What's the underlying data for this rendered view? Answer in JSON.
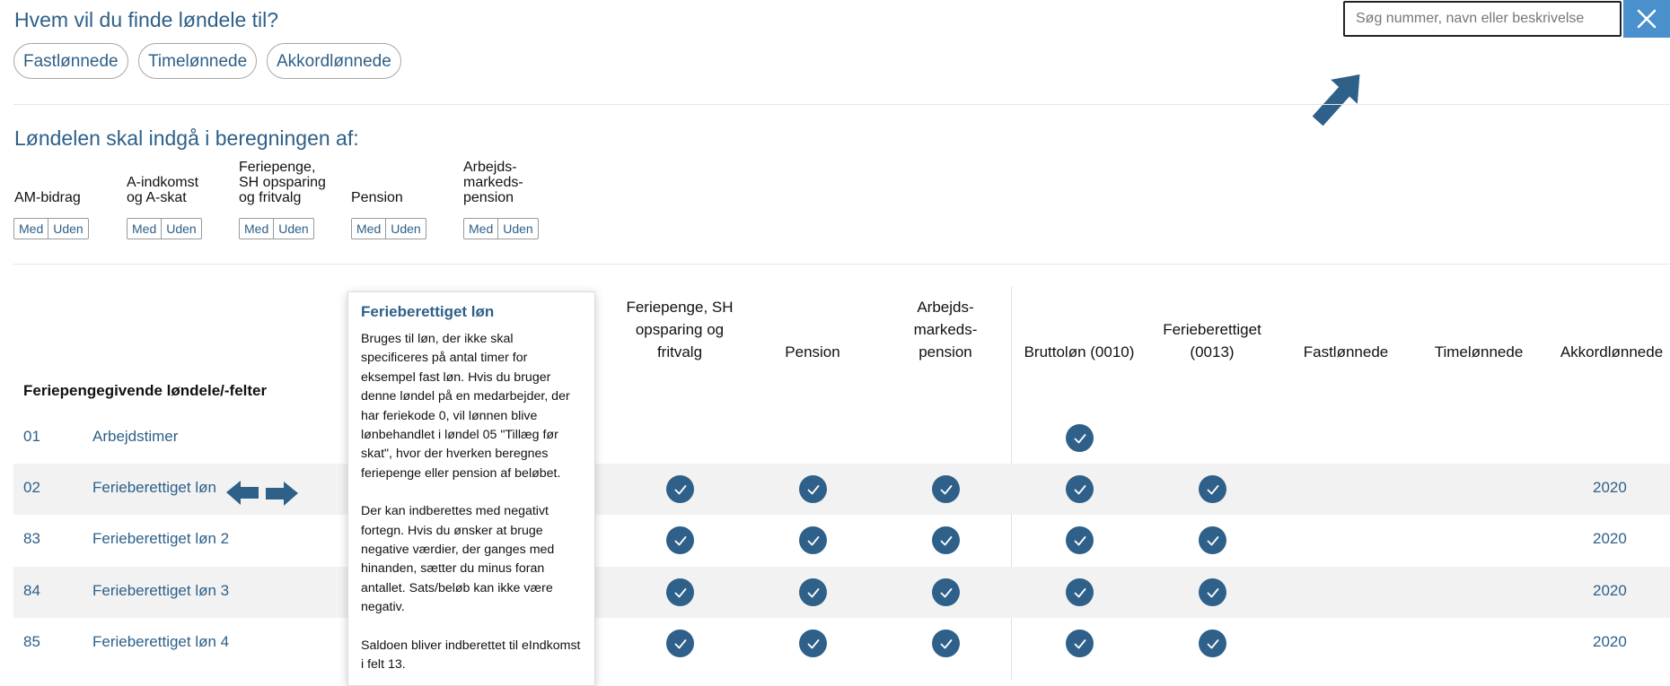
{
  "filter": {
    "heading": "Hvem vil du finde løndele til?",
    "employee_types": [
      "Fastlønnede",
      "Timelønnede",
      "Akkordlønnede"
    ]
  },
  "search": {
    "placeholder": "Søg nummer, navn eller beskrivelse",
    "value": ""
  },
  "inclusion": {
    "heading": "Løndelen skal indgå i beregningen af:",
    "categories": [
      {
        "lines": [
          "AM-bidrag"
        ]
      },
      {
        "lines": [
          "A-indkomst",
          "og A-skat"
        ]
      },
      {
        "lines": [
          "Feriepenge,",
          "SH opsparing",
          "og fritvalg"
        ]
      },
      {
        "lines": [
          "Pension"
        ]
      },
      {
        "lines": [
          "Arbejds-",
          "markeds-",
          "pension"
        ]
      }
    ],
    "with_label": "Med",
    "without_label": "Uden"
  },
  "table": {
    "columns": [
      {
        "lines": [
          "Feriepenge, SH",
          "opsparing og",
          "fritvalg"
        ]
      },
      {
        "lines": [
          "Pension"
        ]
      },
      {
        "lines": [
          "Arbejds-",
          "markeds-",
          "pension"
        ]
      },
      {
        "lines": [
          "Bruttoløn (0010)"
        ]
      },
      {
        "lines": [
          "Ferieberettiget",
          "(0013)"
        ]
      },
      {
        "lines": [
          "Fastlønnede"
        ]
      },
      {
        "lines": [
          "Timelønnede"
        ]
      },
      {
        "lines": [
          "Akkordlønnede"
        ]
      }
    ],
    "section_title": "Feriepengegivende løndele/-felter",
    "rows": [
      {
        "num": "01",
        "name": "Arbejdstimer",
        "checks": [
          false,
          false,
          false,
          true,
          false
        ],
        "year": ""
      },
      {
        "num": "02",
        "name": "Ferieberettiget løn",
        "checks": [
          true,
          true,
          true,
          true,
          true
        ],
        "year": "2020"
      },
      {
        "num": "83",
        "name": "Ferieberettiget løn 2",
        "checks": [
          true,
          true,
          true,
          true,
          true
        ],
        "year": "2020"
      },
      {
        "num": "84",
        "name": "Ferieberettiget løn 3",
        "checks": [
          true,
          true,
          true,
          true,
          true
        ],
        "year": "2020"
      },
      {
        "num": "85",
        "name": "Ferieberettiget løn 4",
        "checks": [
          true,
          true,
          true,
          true,
          true
        ],
        "year": "2020"
      }
    ]
  },
  "tooltip": {
    "title": "Ferieberettiget løn",
    "paragraphs": [
      "Bruges til løn, der ikke skal specificeres på antal timer for eksempel fast løn. Hvis du bruger denne løndel på en medarbejder, der har feriekode 0, vil lønnen blive lønbehandlet i løndel 05 \"Tillæg før skat\", hvor der hverken beregnes feriepenge eller pension af beløbet.",
      "Der kan indberettes med negativt fortegn. Hvis du ønsker at bruge negative værdier, der ganges med hinanden, sætter du minus foran antallet. Sats/beløb kan ikke være negativ.",
      "Saldoen bliver indberettet til eIndkomst i felt 13."
    ]
  },
  "colors": {
    "accent": "#2e6089",
    "close_button": "#4a90cc",
    "row_shade": "#f2f2f2"
  },
  "icons": {
    "close": "close-icon",
    "check": "checkmark-icon",
    "arrow": "arrow-icon"
  }
}
